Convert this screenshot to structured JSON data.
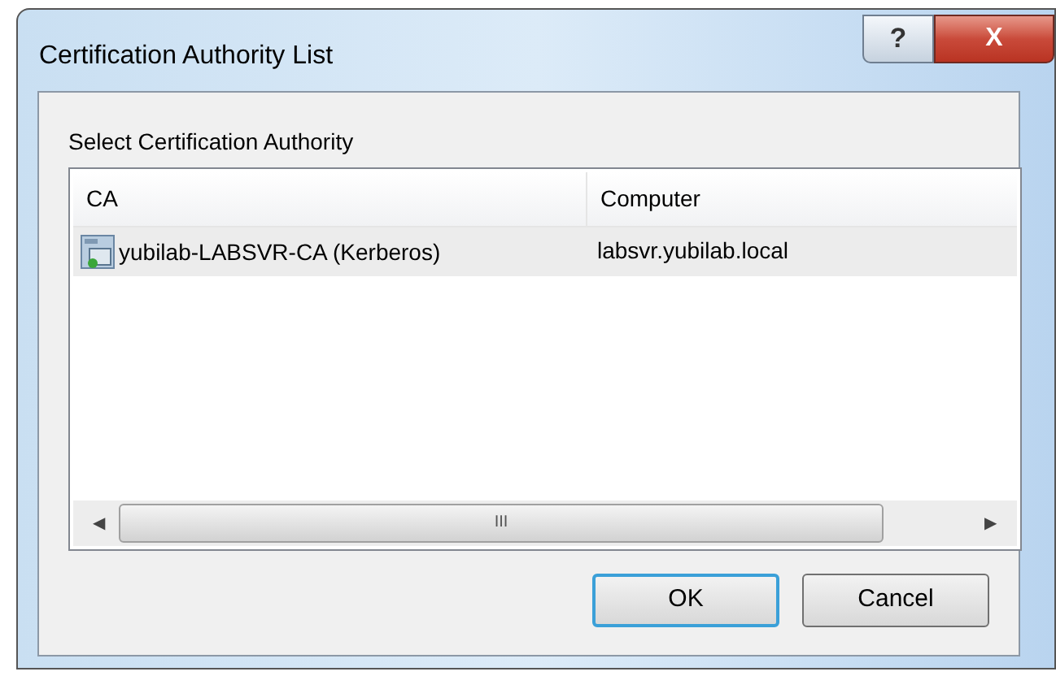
{
  "window": {
    "title": "Certification Authority List",
    "help_button": "?",
    "close_button": "X"
  },
  "group": {
    "label": "Select Certification Authority"
  },
  "list": {
    "columns": [
      "CA",
      "Computer"
    ],
    "rows": [
      {
        "ca": "yubilab-LABSVR-CA (Kerberos)",
        "computer": "labsvr.yubilab.local",
        "selected": true
      }
    ],
    "scroll_arrow_left": "◀",
    "scroll_arrow_right": "▶",
    "scroll_grip": "III"
  },
  "buttons": [
    {
      "label": "OK",
      "default": true
    },
    {
      "label": "Cancel",
      "default": false
    }
  ]
}
